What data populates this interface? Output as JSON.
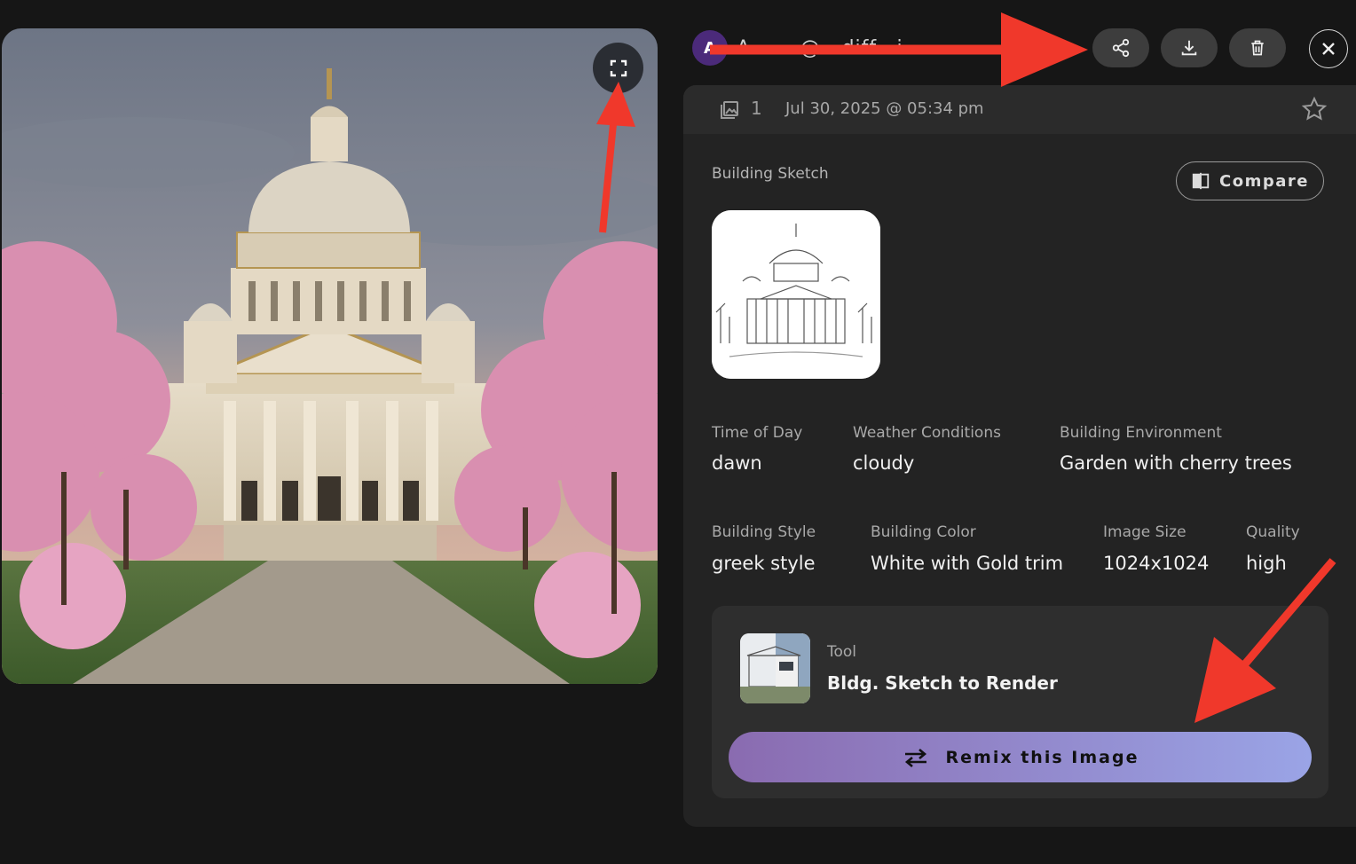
{
  "header": {
    "avatar_initial": "A",
    "username": "A... ...@...diff...i",
    "share_icon": "share-icon",
    "download_icon": "download-icon",
    "delete_icon": "trash-icon",
    "close_icon": "close-icon"
  },
  "panel": {
    "image_count": "1",
    "date": "Jul 30, 2025 @ 05:34 pm",
    "sketch_label": "Building Sketch",
    "compare_label": "Compare",
    "attributes_row1": [
      {
        "label": "Time of Day",
        "value": "dawn"
      },
      {
        "label": "Weather Conditions",
        "value": "cloudy"
      },
      {
        "label": "Building Environment",
        "value": "Garden with cherry trees"
      }
    ],
    "attributes_row2": [
      {
        "label": "Building Style",
        "value": "greek style"
      },
      {
        "label": "Building Color",
        "value": "White with Gold trim"
      },
      {
        "label": "Image Size",
        "value": "1024x1024"
      },
      {
        "label": "Quality",
        "value": "high"
      }
    ],
    "tool": {
      "label": "Tool",
      "name": "Bldg. Sketch to Render"
    },
    "remix_label": "Remix this Image"
  },
  "colors": {
    "background": "#161616",
    "panel": "#232323",
    "remix_gradient_start": "#8a6bb0",
    "remix_gradient_end": "#9aa4e6",
    "annotation_arrow": "#f0382b"
  }
}
